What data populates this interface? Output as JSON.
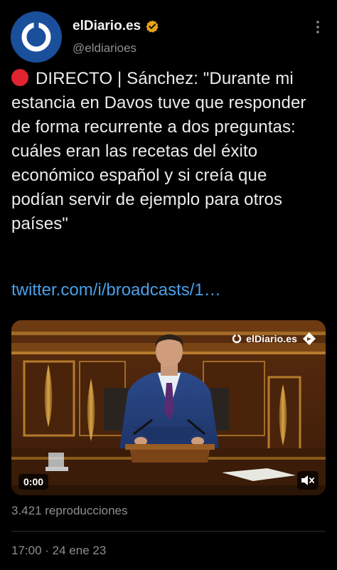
{
  "header": {
    "display_name": "elDiario.es",
    "handle": "@eldiarioes",
    "avatar_icon": "eldiario-logo-icon",
    "verified_icon": "verified-badge-icon",
    "more_icon": "more-vertical-icon"
  },
  "tweet": {
    "live_icon": "red-circle-icon",
    "text": "DIRECTO | Sánchez: \"Durante mi estancia en Davos tuve que responder de forma recurrente a dos preguntas: cuáles eran las recetas del éxito económico español y si creía que podían servir de ejemplo para otros países\"",
    "link": "twitter.com/i/broadcasts/1…"
  },
  "media": {
    "watermark": "elDiario.es",
    "timecode": "0:00",
    "mute_icon": "volume-muted-icon"
  },
  "stats": {
    "views": "3.421 reproducciones"
  },
  "meta": {
    "timestamp": "17:00 · 24 ene 23"
  },
  "colors": {
    "background": "#000000",
    "link": "#4a9fe8",
    "secondary_text": "#8b8f93",
    "verified": "#e8a317",
    "live": "#e0242f",
    "avatar": "#1a4f9c"
  }
}
